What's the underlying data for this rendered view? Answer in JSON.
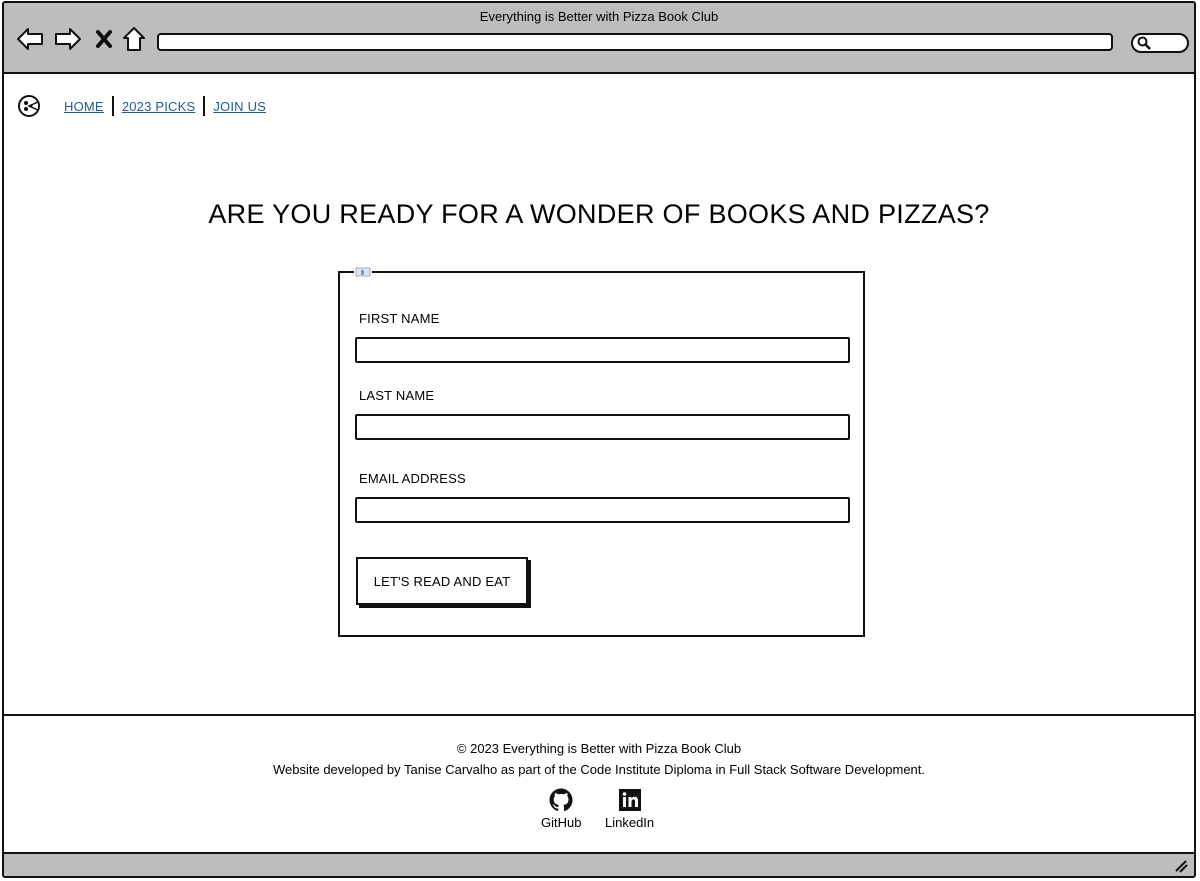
{
  "window": {
    "title": "Everything is Better with Pizza Book Club",
    "address_value": ""
  },
  "nav": {
    "links": [
      {
        "label": "HOME"
      },
      {
        "label": "2023 PICKS"
      },
      {
        "label": "JOIN US"
      }
    ]
  },
  "main": {
    "heading": "ARE YOU READY FOR A WONDER OF BOOKS AND PIZZAS?",
    "form": {
      "fields": [
        {
          "label": "FIRST NAME",
          "value": ""
        },
        {
          "label": "LAST NAME",
          "value": ""
        },
        {
          "label": "EMAIL ADDRESS",
          "value": ""
        }
      ],
      "submit_label": "LET'S READ AND EAT"
    }
  },
  "footer": {
    "copyright": "© 2023 Everything is Better with Pizza Book Club",
    "credit": "Website developed by Tanise Carvalho as part of the Code Institute Diploma in Full Stack Software Development.",
    "social": [
      {
        "label": "GitHub",
        "icon": "github-icon"
      },
      {
        "label": "LinkedIn",
        "icon": "linkedin-icon"
      }
    ]
  },
  "colors": {
    "link": "#1f5a9e",
    "chrome": "#bdbdbd",
    "stroke": "#111111"
  }
}
